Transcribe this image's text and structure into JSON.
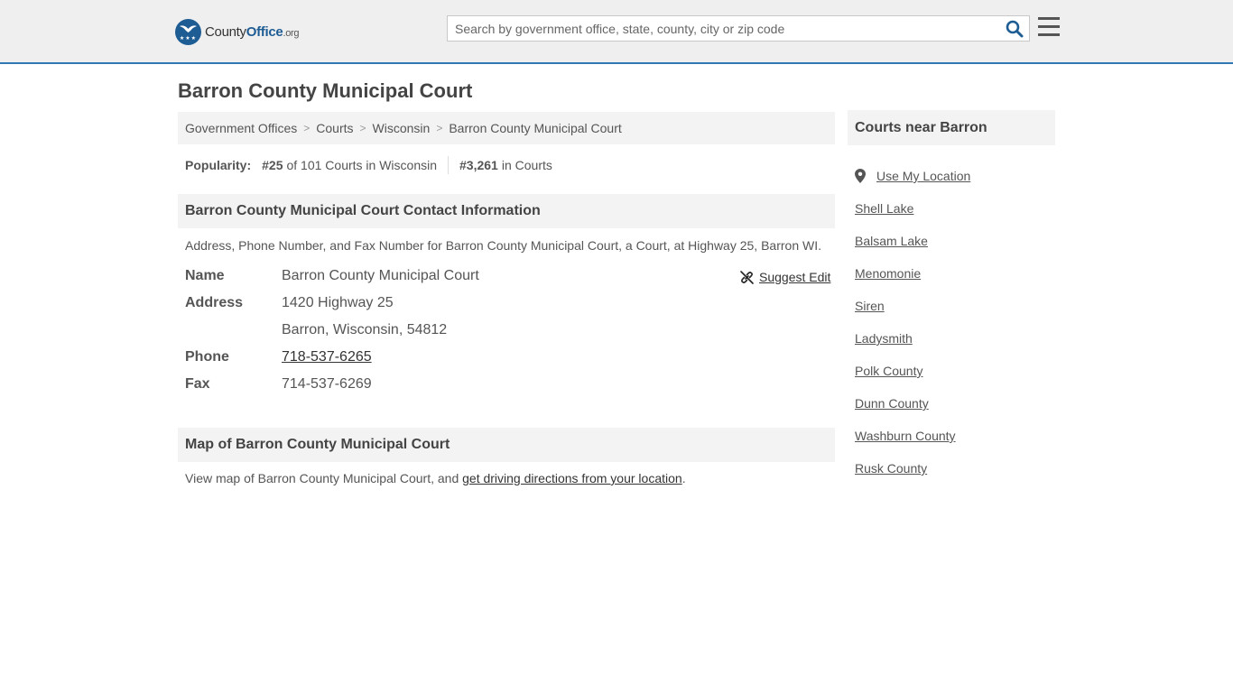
{
  "header": {
    "logo": {
      "brand_part1": "County",
      "brand_part2": "Office",
      "tld": ".org"
    },
    "search": {
      "placeholder": "Search by government office, state, county, city or zip code",
      "icon": "search-icon"
    },
    "menu_icon": "hamburger-menu-icon",
    "accent_color": "#2f78b4"
  },
  "page": {
    "title": "Barron County Municipal Court",
    "breadcrumb": [
      "Government Offices",
      "Courts",
      "Wisconsin",
      "Barron County Municipal Court"
    ],
    "popularity": {
      "label": "Popularity:",
      "state_rank": "#25",
      "state_rank_text": "of 101 Courts in Wisconsin",
      "national_rank": "#3,261",
      "national_rank_text": "in Courts"
    },
    "contact": {
      "heading": "Barron County Municipal Court Contact Information",
      "description": "Address, Phone Number, and Fax Number for Barron County Municipal Court, a Court, at Highway 25, Barron WI.",
      "suggest_edit": "Suggest Edit",
      "name_label": "Name",
      "name_value": "Barron County Municipal Court",
      "address_label": "Address",
      "address_line1": "1420 Highway 25",
      "address_line2": "Barron, Wisconsin, 54812",
      "phone_label": "Phone",
      "phone_value": "718-537-6265",
      "fax_label": "Fax",
      "fax_value": "714-537-6269"
    },
    "map": {
      "heading": "Map of Barron County Municipal Court",
      "desc_prefix": "View map of Barron County Municipal Court, and ",
      "desc_link": "get driving directions from your location",
      "desc_suffix": "."
    }
  },
  "sidebar": {
    "heading": "Courts near Barron",
    "use_location": "Use My Location",
    "items": [
      "Shell Lake",
      "Balsam Lake",
      "Menomonie",
      "Siren",
      "Ladysmith",
      "Polk County",
      "Dunn County",
      "Washburn County",
      "Rusk County"
    ]
  }
}
